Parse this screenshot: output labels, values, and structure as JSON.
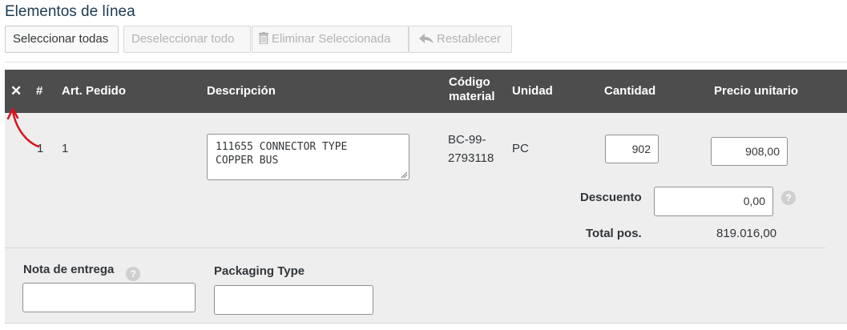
{
  "page": {
    "title": "Elementos de línea"
  },
  "toolbar": {
    "select_all": "Seleccionar todas",
    "deselect_all": "Deseleccionar todo",
    "delete_selected": "Eliminar Seleccionada",
    "reset": "Restablecer"
  },
  "table": {
    "headers": {
      "close": "✕",
      "num": "#",
      "order_item": "Art. Pedido",
      "description": "Descripción",
      "material_code_1": "Código",
      "material_code_2": "material",
      "unit": "Unidad",
      "quantity": "Cantidad",
      "unit_price": "Precio unitario"
    },
    "rows": [
      {
        "num": "1",
        "order_item": "1",
        "description": "111655 CONNECTOR TYPE\nCOPPER BUS",
        "material_code_1": "BC-99-",
        "material_code_2": "2793118",
        "unit": "PC",
        "quantity": "902",
        "unit_price": "908,00",
        "discount_label": "Descuento",
        "discount": "0,00",
        "total_label": "Total pos.",
        "total": "819.016,00"
      }
    ]
  },
  "footer_fields": {
    "delivery_note_label": "Nota de entrega",
    "delivery_note_value": "",
    "packaging_type_label": "Packaging Type",
    "packaging_type_value": ""
  },
  "icons": {
    "close": "close-icon",
    "trash": "trash-icon",
    "undo": "undo-arrow-icon",
    "help": "help-icon",
    "annotation": "red-annotation-arrow"
  },
  "colors": {
    "header_bg": "#4d4d4d",
    "row_bg": "#eeeeee",
    "annotation": "#d9141e",
    "title": "#1e3a50"
  }
}
